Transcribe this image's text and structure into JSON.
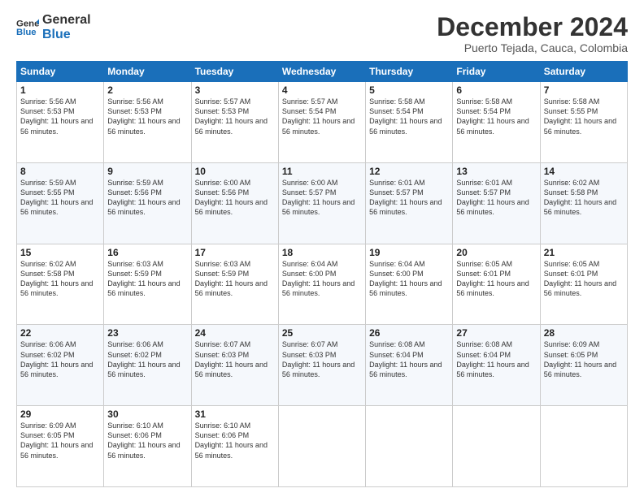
{
  "logo": {
    "line1": "General",
    "line2": "Blue"
  },
  "title": "December 2024",
  "location": "Puerto Tejada, Cauca, Colombia",
  "days_header": [
    "Sunday",
    "Monday",
    "Tuesday",
    "Wednesday",
    "Thursday",
    "Friday",
    "Saturday"
  ],
  "weeks": [
    [
      {
        "day": "1",
        "sunrise": "5:56 AM",
        "sunset": "5:53 PM",
        "daylight": "11 hours and 56 minutes."
      },
      {
        "day": "2",
        "sunrise": "5:56 AM",
        "sunset": "5:53 PM",
        "daylight": "11 hours and 56 minutes."
      },
      {
        "day": "3",
        "sunrise": "5:57 AM",
        "sunset": "5:53 PM",
        "daylight": "11 hours and 56 minutes."
      },
      {
        "day": "4",
        "sunrise": "5:57 AM",
        "sunset": "5:54 PM",
        "daylight": "11 hours and 56 minutes."
      },
      {
        "day": "5",
        "sunrise": "5:58 AM",
        "sunset": "5:54 PM",
        "daylight": "11 hours and 56 minutes."
      },
      {
        "day": "6",
        "sunrise": "5:58 AM",
        "sunset": "5:54 PM",
        "daylight": "11 hours and 56 minutes."
      },
      {
        "day": "7",
        "sunrise": "5:58 AM",
        "sunset": "5:55 PM",
        "daylight": "11 hours and 56 minutes."
      }
    ],
    [
      {
        "day": "8",
        "sunrise": "5:59 AM",
        "sunset": "5:55 PM",
        "daylight": "11 hours and 56 minutes."
      },
      {
        "day": "9",
        "sunrise": "5:59 AM",
        "sunset": "5:56 PM",
        "daylight": "11 hours and 56 minutes."
      },
      {
        "day": "10",
        "sunrise": "6:00 AM",
        "sunset": "5:56 PM",
        "daylight": "11 hours and 56 minutes."
      },
      {
        "day": "11",
        "sunrise": "6:00 AM",
        "sunset": "5:57 PM",
        "daylight": "11 hours and 56 minutes."
      },
      {
        "day": "12",
        "sunrise": "6:01 AM",
        "sunset": "5:57 PM",
        "daylight": "11 hours and 56 minutes."
      },
      {
        "day": "13",
        "sunrise": "6:01 AM",
        "sunset": "5:57 PM",
        "daylight": "11 hours and 56 minutes."
      },
      {
        "day": "14",
        "sunrise": "6:02 AM",
        "sunset": "5:58 PM",
        "daylight": "11 hours and 56 minutes."
      }
    ],
    [
      {
        "day": "15",
        "sunrise": "6:02 AM",
        "sunset": "5:58 PM",
        "daylight": "11 hours and 56 minutes."
      },
      {
        "day": "16",
        "sunrise": "6:03 AM",
        "sunset": "5:59 PM",
        "daylight": "11 hours and 56 minutes."
      },
      {
        "day": "17",
        "sunrise": "6:03 AM",
        "sunset": "5:59 PM",
        "daylight": "11 hours and 56 minutes."
      },
      {
        "day": "18",
        "sunrise": "6:04 AM",
        "sunset": "6:00 PM",
        "daylight": "11 hours and 56 minutes."
      },
      {
        "day": "19",
        "sunrise": "6:04 AM",
        "sunset": "6:00 PM",
        "daylight": "11 hours and 56 minutes."
      },
      {
        "day": "20",
        "sunrise": "6:05 AM",
        "sunset": "6:01 PM",
        "daylight": "11 hours and 56 minutes."
      },
      {
        "day": "21",
        "sunrise": "6:05 AM",
        "sunset": "6:01 PM",
        "daylight": "11 hours and 56 minutes."
      }
    ],
    [
      {
        "day": "22",
        "sunrise": "6:06 AM",
        "sunset": "6:02 PM",
        "daylight": "11 hours and 56 minutes."
      },
      {
        "day": "23",
        "sunrise": "6:06 AM",
        "sunset": "6:02 PM",
        "daylight": "11 hours and 56 minutes."
      },
      {
        "day": "24",
        "sunrise": "6:07 AM",
        "sunset": "6:03 PM",
        "daylight": "11 hours and 56 minutes."
      },
      {
        "day": "25",
        "sunrise": "6:07 AM",
        "sunset": "6:03 PM",
        "daylight": "11 hours and 56 minutes."
      },
      {
        "day": "26",
        "sunrise": "6:08 AM",
        "sunset": "6:04 PM",
        "daylight": "11 hours and 56 minutes."
      },
      {
        "day": "27",
        "sunrise": "6:08 AM",
        "sunset": "6:04 PM",
        "daylight": "11 hours and 56 minutes."
      },
      {
        "day": "28",
        "sunrise": "6:09 AM",
        "sunset": "6:05 PM",
        "daylight": "11 hours and 56 minutes."
      }
    ],
    [
      {
        "day": "29",
        "sunrise": "6:09 AM",
        "sunset": "6:05 PM",
        "daylight": "11 hours and 56 minutes."
      },
      {
        "day": "30",
        "sunrise": "6:10 AM",
        "sunset": "6:06 PM",
        "daylight": "11 hours and 56 minutes."
      },
      {
        "day": "31",
        "sunrise": "6:10 AM",
        "sunset": "6:06 PM",
        "daylight": "11 hours and 56 minutes."
      },
      null,
      null,
      null,
      null
    ]
  ]
}
